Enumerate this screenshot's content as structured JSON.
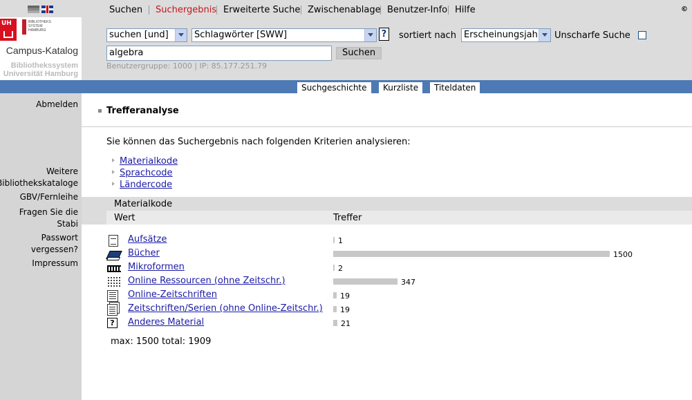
{
  "topnav": {
    "items": [
      "Suchen",
      "Suchergebnis",
      "Erweiterte Suche",
      "Zwischenablage",
      "Benutzer-Info",
      "Hilfe"
    ],
    "active_index": 1,
    "copyright": "©"
  },
  "logo": {
    "uh_text": "UH",
    "library_text": "BIBLIOTHEKS\nSYSTEM\nHAMBURG",
    "campus_title": "Campus-Katalog",
    "system_line1": "Bibliothekssystem",
    "system_line2": "Universität Hamburg"
  },
  "search": {
    "mode": "suchen [und]",
    "field": "Schlagwörter [SWW]",
    "help_label": "?",
    "sort_label": "sortiert nach",
    "sort_value": "Erscheinungsjahr",
    "fuzzy_label": "Unscharfe Suche",
    "fuzzy_checked": false,
    "query": "algebra",
    "button_label": "Suchen",
    "usergroup": "Benutzergruppe: 1000 | IP: 85.177.251.79"
  },
  "tabs": [
    "Suchgeschichte",
    "Kurzliste",
    "Titeldaten"
  ],
  "sidebar": {
    "logout": "Abmelden",
    "links": [
      {
        "line1": "Weitere",
        "line2": "Bibliothekskataloge"
      },
      {
        "line1": "GBV/Fernleihe",
        "line2": ""
      },
      {
        "line1": "Fragen Sie die",
        "line2": "Stabi"
      },
      {
        "line1": "Passwort",
        "line2": "vergessen?"
      },
      {
        "line1": "Impressum",
        "line2": ""
      }
    ]
  },
  "main": {
    "heading": "Trefferanalyse",
    "intro": "Sie können das Suchergebnis nach folgenden Kriterien analysieren:",
    "criteria": [
      "Materialkode",
      "Sprachcode",
      "Ländercode"
    ],
    "table": {
      "title": "Materialkode",
      "col_value": "Wert",
      "col_hits": "Treffer",
      "rows": [
        {
          "icon": "document-icon",
          "label": "Aufsätze",
          "hits": 1
        },
        {
          "icon": "book-icon",
          "label": "Bücher",
          "hits": 1500
        },
        {
          "icon": "microform-icon",
          "label": "Mikroformen",
          "hits": 2
        },
        {
          "icon": "online-resource-icon",
          "label": "Online Ressourcen (ohne Zeitschr.)",
          "hits": 347
        },
        {
          "icon": "online-journal-icon",
          "label": "Online-Zeitschriften",
          "hits": 19
        },
        {
          "icon": "journal-series-icon",
          "label": "Zeitschriften/Serien (ohne Online-Zeitschr.)",
          "hits": 19
        },
        {
          "icon": "other-material-icon",
          "label": "Anderes Material",
          "hits": 21
        }
      ],
      "max": 1500
    },
    "summary": "max: 1500 total: 1909"
  }
}
